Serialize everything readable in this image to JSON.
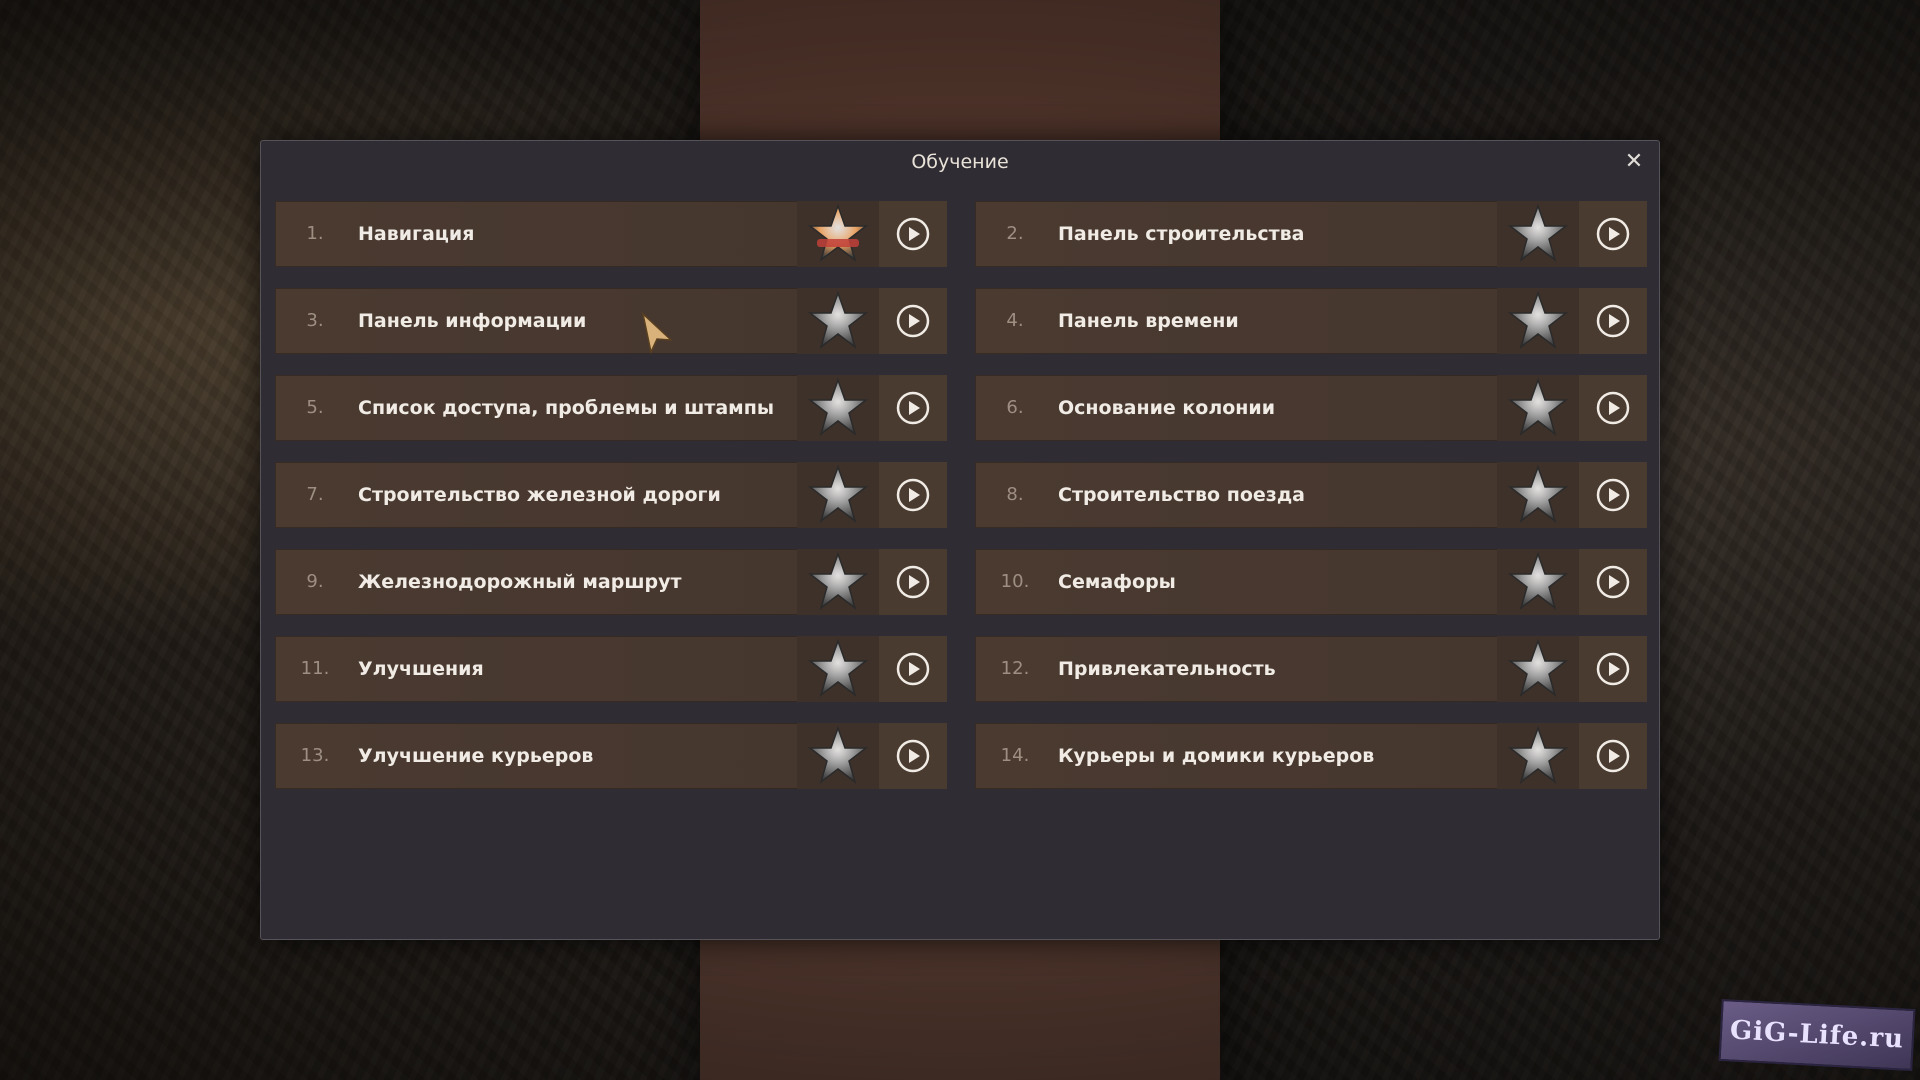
{
  "dialog": {
    "title": "Обучение",
    "close_glyph": "✕"
  },
  "tutorials": [
    {
      "num": "1.",
      "label": "Навигация",
      "completed": true
    },
    {
      "num": "2.",
      "label": "Панель строительства",
      "completed": false
    },
    {
      "num": "3.",
      "label": "Панель информации",
      "completed": false
    },
    {
      "num": "4.",
      "label": "Панель времени",
      "completed": false
    },
    {
      "num": "5.",
      "label": "Список доступа, проблемы и штампы",
      "completed": false
    },
    {
      "num": "6.",
      "label": "Основание колонии",
      "completed": false
    },
    {
      "num": "7.",
      "label": "Строительство железной дороги",
      "completed": false
    },
    {
      "num": "8.",
      "label": "Строительство поезда",
      "completed": false
    },
    {
      "num": "9.",
      "label": "Железнодорожный маршрут",
      "completed": false
    },
    {
      "num": "10.",
      "label": "Семафоры",
      "completed": false
    },
    {
      "num": "11.",
      "label": "Улучшения",
      "completed": false
    },
    {
      "num": "12.",
      "label": "Привлекательность",
      "completed": false
    },
    {
      "num": "13.",
      "label": "Улучшение курьеров",
      "completed": false
    },
    {
      "num": "14.",
      "label": "Курьеры и домики курьеров",
      "completed": false
    }
  ],
  "icons": {
    "star": "star-icon",
    "play": "play-icon",
    "close": "close-icon",
    "cursor": "cursor-icon"
  },
  "colors": {
    "star_completed": "#e8a060",
    "star_locked": "#8a8a8a",
    "row_bg": "#4a3a30",
    "dialog_bg": "#2f2c33"
  },
  "watermark": "GiG-Life.ru"
}
